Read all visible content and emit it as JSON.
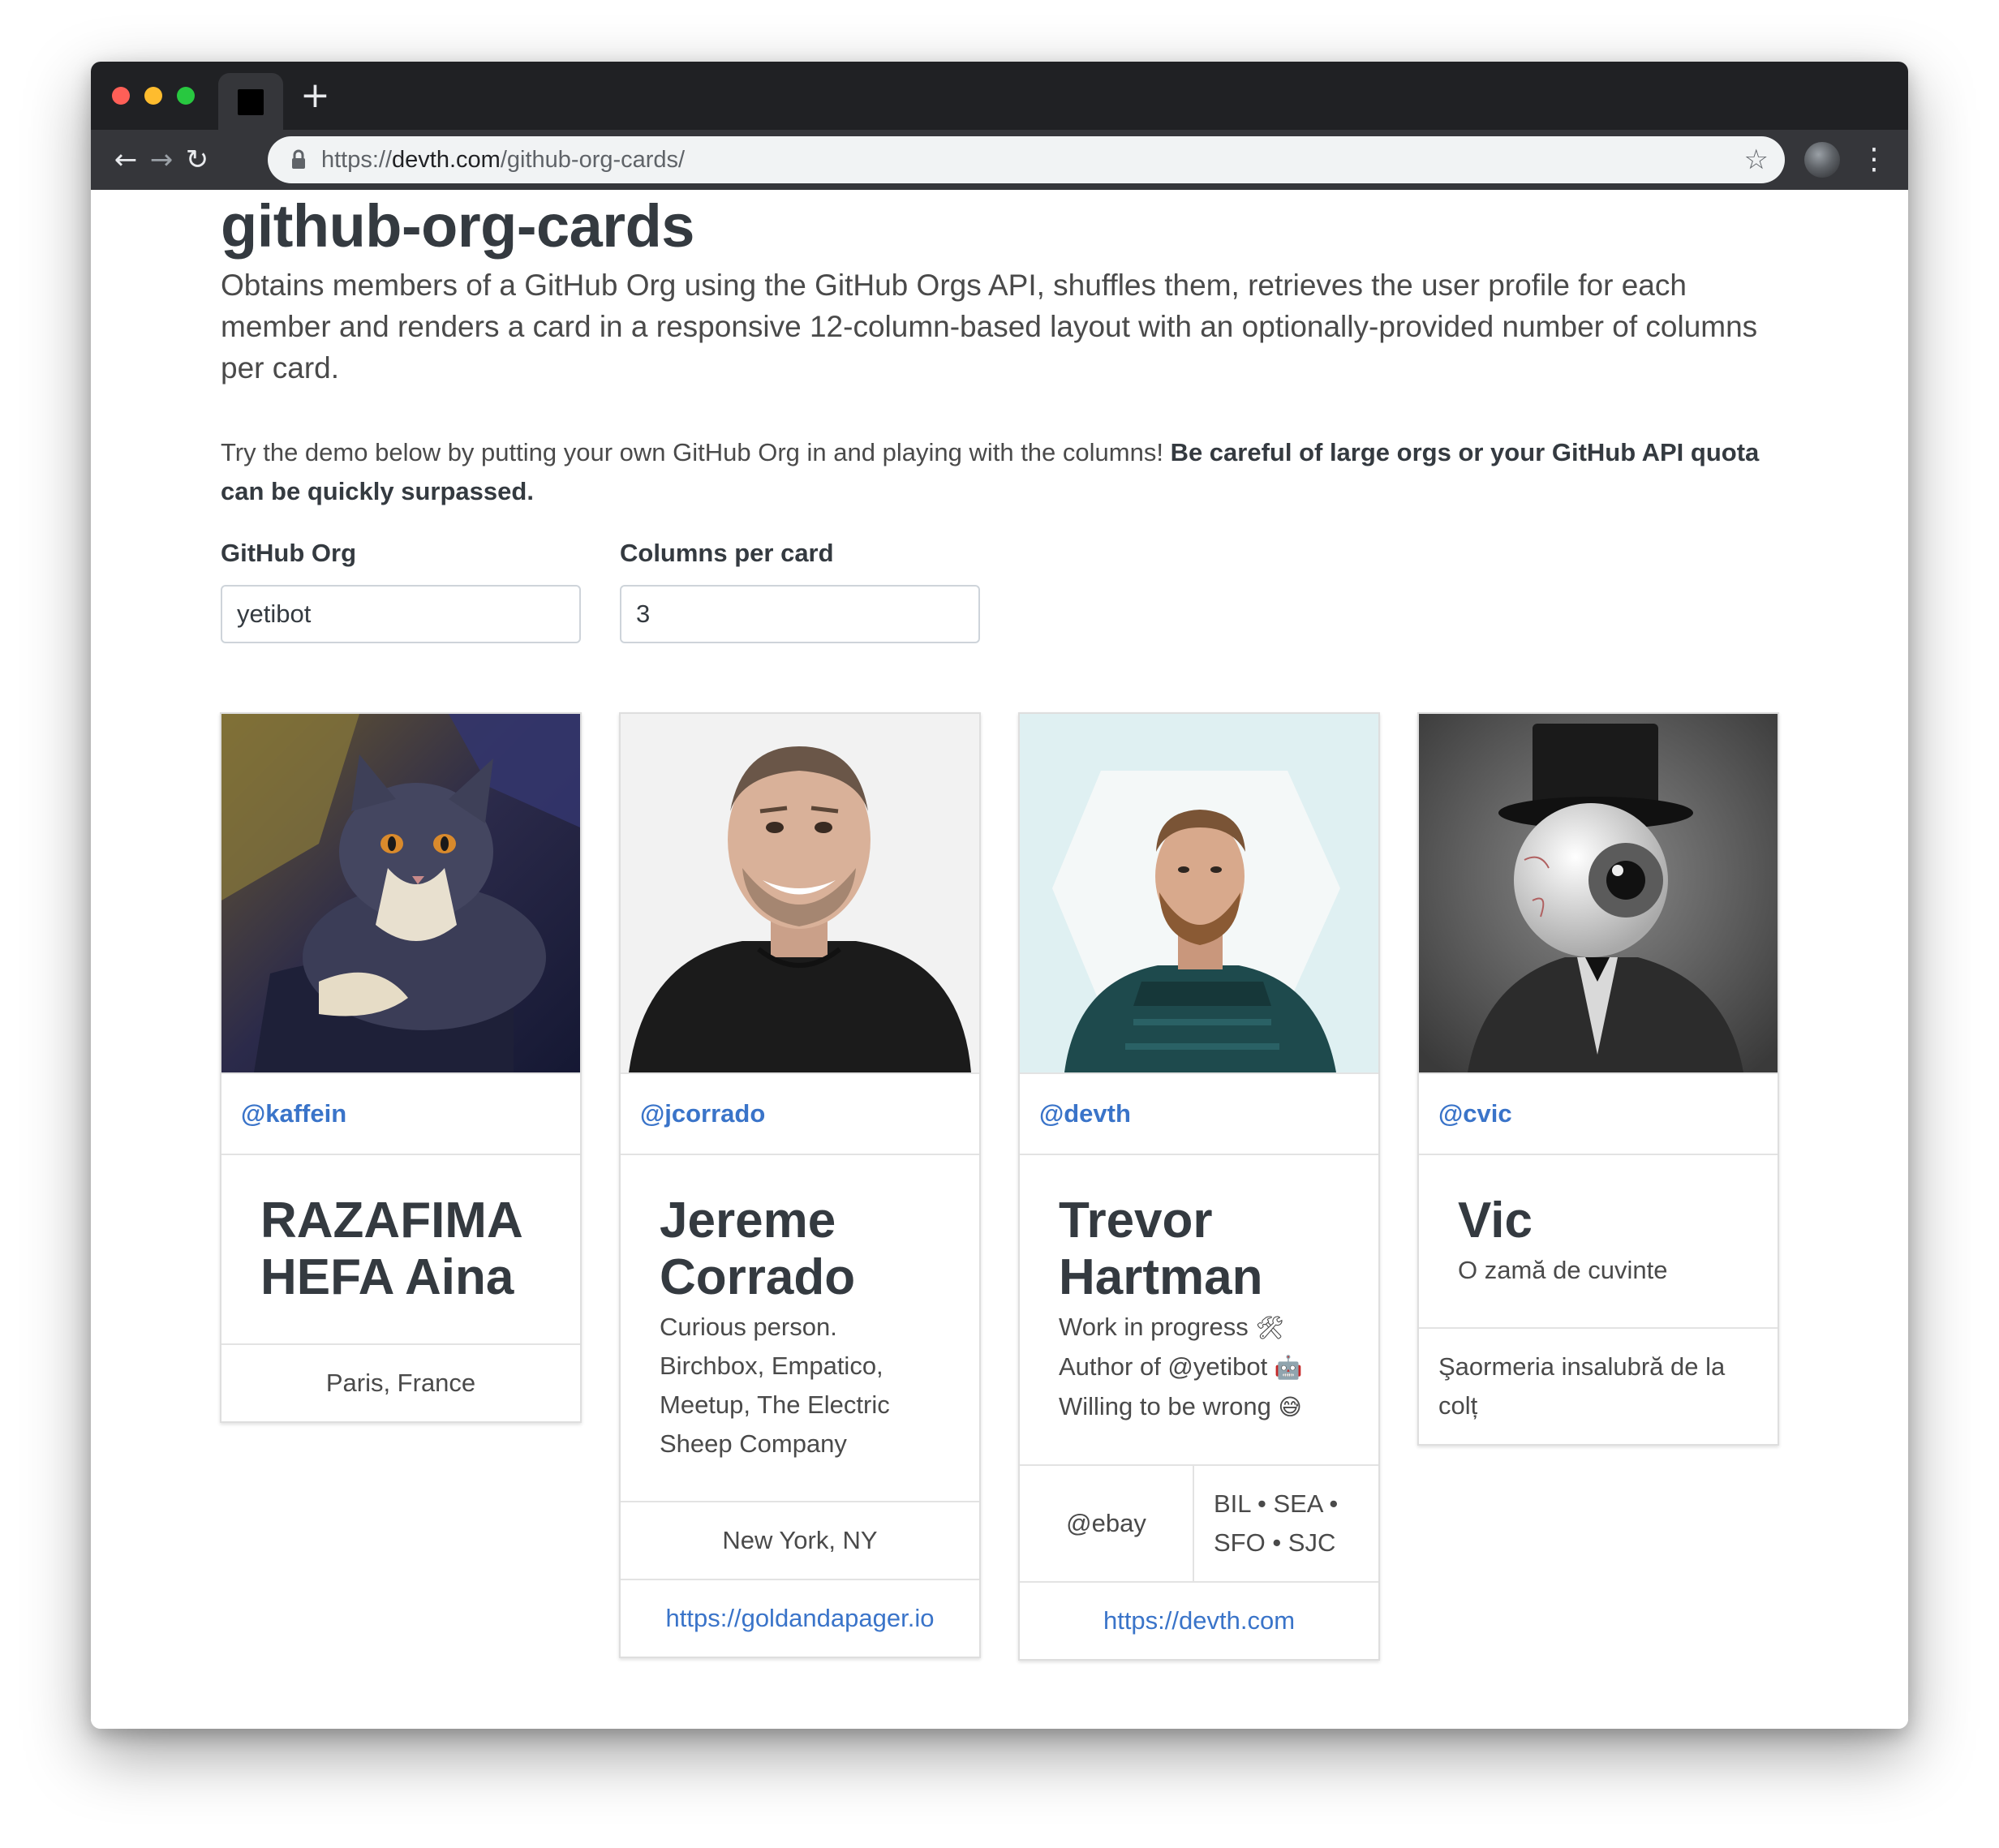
{
  "browser": {
    "url_scheme": "https://",
    "url_host": "devth.com",
    "url_path": "/github-org-cards/",
    "new_tab_glyph": "+",
    "back_glyph": "←",
    "forward_glyph": "→",
    "reload_glyph": "↻",
    "lock_glyph": "🔒",
    "bookmark_glyph": "☆",
    "menu_glyph": "⋮"
  },
  "page": {
    "title": "github-org-cards",
    "lead": "Obtains members of a GitHub Org using the GitHub Orgs API, shuffles them, retrieves the user profile for each member and renders a card in a responsive 12-column-based layout with an optionally-provided number of columns per card.",
    "try_text": "Try the demo below by putting your own GitHub Org in and playing with the columns! ",
    "try_warning": "Be careful of large orgs or your GitHub API quota can be quickly surpassed."
  },
  "form": {
    "org_label": "GitHub Org",
    "org_value": "yetibot",
    "columns_label": "Columns per card",
    "columns_value": "3"
  },
  "cards": [
    {
      "login": "@kaffein",
      "name": "RAZAFIMA HEFA Aina",
      "location": "Paris, France"
    },
    {
      "login": "@jcorrado",
      "name": "Jereme Corrado",
      "bio": "Curious person. Birchbox, Empatico, Meetup, The Electric Sheep Company",
      "location": "New York, NY",
      "blog": "https://goldandapager.io"
    },
    {
      "login": "@devth",
      "name": "Trevor Hartman",
      "bio_lines": [
        "Work in progress",
        "Author of @yetibot",
        "Willing to be wrong"
      ],
      "bio_emoji": [
        "🛠",
        "🤖",
        "😅"
      ],
      "company": "@ebay",
      "location": "BIL • SEA • SFO • SJC",
      "blog": "https://devth.com"
    },
    {
      "login": "@cvic",
      "name": "Vic",
      "bio": "O zamă de cuvinte",
      "location": "Şaormeria insalubră de la colț"
    }
  ],
  "colors": {
    "link": "#3a74c9",
    "heading": "#343a40",
    "body_text": "#4a4a4a",
    "chrome_dark": "#202124",
    "chrome_toolbar": "#35363a"
  }
}
